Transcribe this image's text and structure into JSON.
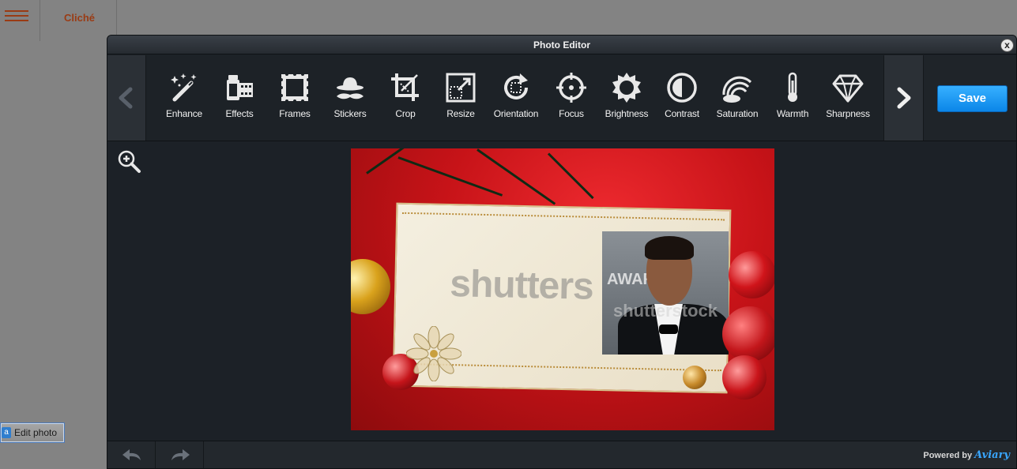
{
  "background_app": {
    "title": "Cliché",
    "edit_photo_label": "Edit photo"
  },
  "editor": {
    "title": "Photo Editor",
    "close_label": "x",
    "save_label": "Save",
    "tools": [
      {
        "label": "Enhance",
        "icon": "magic-wand-icon"
      },
      {
        "label": "Effects",
        "icon": "film-icon"
      },
      {
        "label": "Frames",
        "icon": "frame-icon"
      },
      {
        "label": "Stickers",
        "icon": "mustache-hat-icon"
      },
      {
        "label": "Crop",
        "icon": "crop-icon"
      },
      {
        "label": "Resize",
        "icon": "resize-icon"
      },
      {
        "label": "Orientation",
        "icon": "rotate-icon"
      },
      {
        "label": "Focus",
        "icon": "target-icon"
      },
      {
        "label": "Brightness",
        "icon": "sun-icon"
      },
      {
        "label": "Contrast",
        "icon": "contrast-icon"
      },
      {
        "label": "Saturation",
        "icon": "rainbow-icon"
      },
      {
        "label": "Warmth",
        "icon": "thermometer-icon"
      },
      {
        "label": "Sharpness",
        "icon": "diamond-icon"
      }
    ],
    "photo": {
      "watermark": "shutters",
      "portrait_watermark": "shutterstock",
      "portrait_backdrop": "AWAR"
    },
    "footer": {
      "powered_by": "Powered by",
      "brand": "Aviary"
    }
  },
  "colors": {
    "accent_brand": "#9a3b14",
    "save_button": "#1a95f0",
    "editor_bg": "#1c2127"
  }
}
